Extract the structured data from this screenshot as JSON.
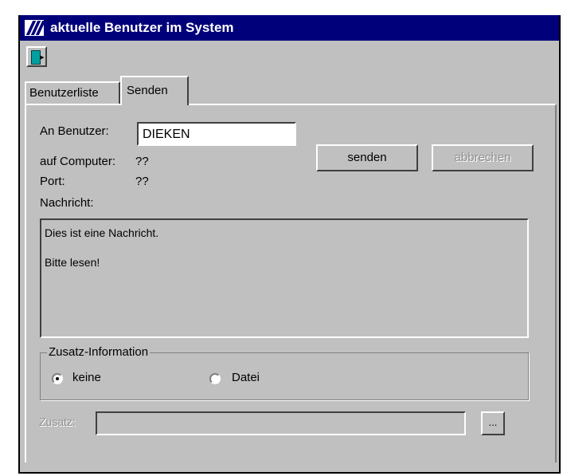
{
  "window": {
    "title": "aktuelle Benutzer im System"
  },
  "toolbar": {
    "exit_icon": "exit-door-icon"
  },
  "tabs": [
    {
      "label": "Benutzerliste",
      "active": false
    },
    {
      "label": "Senden",
      "active": true
    }
  ],
  "form": {
    "to_user_label": "An Benutzer:",
    "to_user_value": "DIEKEN",
    "computer_label": "auf Computer:",
    "computer_value": "??",
    "port_label": "Port:",
    "port_value": "??",
    "message_label": "Nachricht:",
    "message_lines": [
      "Dies ist eine Nachricht.",
      "Bitte lesen!"
    ],
    "send_button": "senden",
    "cancel_button": "abbrechen",
    "extra_group_label": "Zusatz-Information",
    "option_none": "keine",
    "option_file": "Datei",
    "selected_option": "keine",
    "extra_label": "Zusatz:",
    "extra_value": "",
    "browse_button": "..."
  }
}
